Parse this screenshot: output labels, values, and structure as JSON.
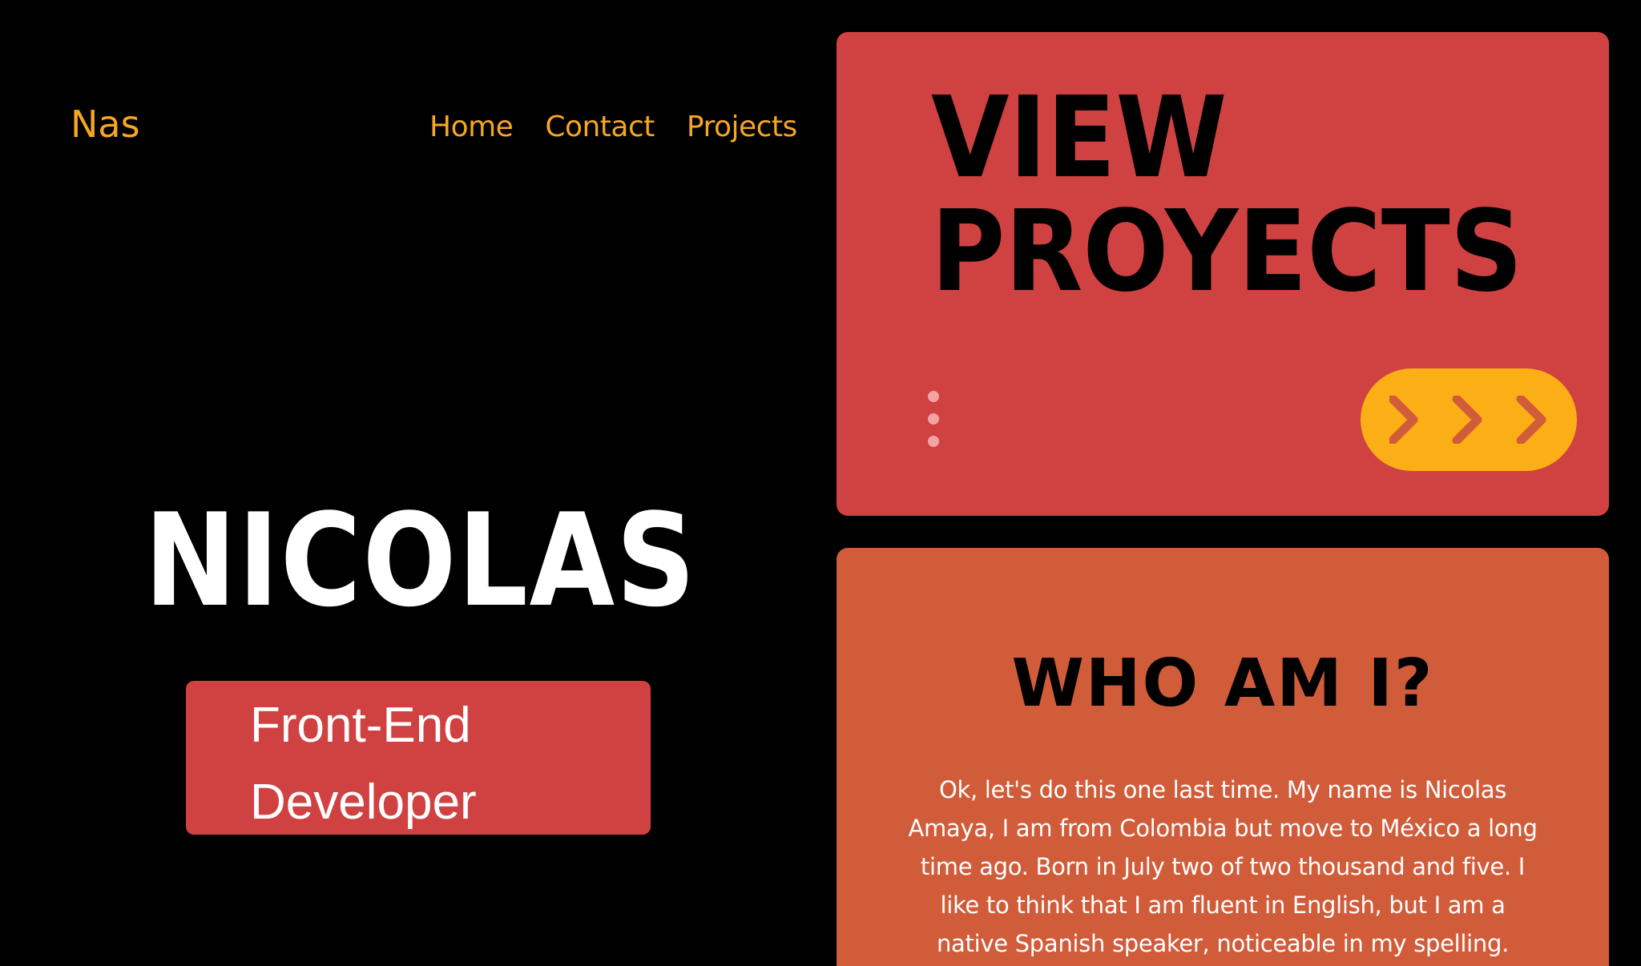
{
  "header": {
    "logo": "Nas",
    "nav": [
      {
        "label": "Home"
      },
      {
        "label": "Contact"
      },
      {
        "label": "Projects"
      }
    ]
  },
  "hero": {
    "name": "NICOLAS",
    "role_line1": "Front-End",
    "role_line2": "Developer"
  },
  "projects_card": {
    "title_line1": "VIEW",
    "title_line2": "PROYECTS",
    "button_icon": "triple-chevron-right-icon",
    "menu_icon": "vertical-dots-icon"
  },
  "about_card": {
    "title": "WHO AM I?",
    "text": "Ok, let's do this one last time. My name is Nicolas Amaya, I am from Colombia but move to México a long time ago. Born in July two of two thousand and five. I like to think that I am fluent in English, but I am a native Spanish speaker, noticeable in my spelling."
  },
  "colors": {
    "background": "#000000",
    "accent_yellow": "#f5a623",
    "card_red": "#d04242",
    "card_orange": "#d15c3a",
    "button_yellow": "#fcae16",
    "chevron": "#d15c3a"
  }
}
